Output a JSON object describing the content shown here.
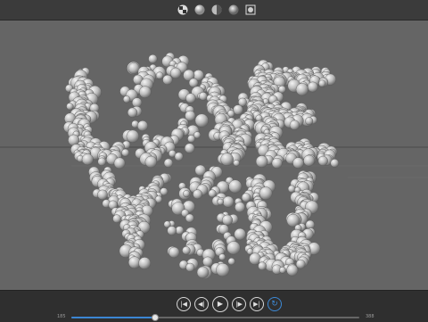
{
  "toolbar": {
    "icons": [
      {
        "name": "checker-render-icon"
      },
      {
        "name": "solid-sphere-icon"
      },
      {
        "name": "material-sphere-icon"
      },
      {
        "name": "shaded-sphere-icon"
      },
      {
        "name": "frame-select-icon"
      }
    ]
  },
  "viewport": {
    "background": "#656565",
    "text_line1": "LOVE",
    "text_line2": "YOU",
    "sphere_color": "#c9c9c9"
  },
  "playback": {
    "buttons": [
      "skip-to-start",
      "step-back",
      "play",
      "step-forward",
      "skip-to-end",
      "loop"
    ],
    "frame_start": "185",
    "frame_end": "388",
    "progress": 0.29,
    "accent": "#3b86d3"
  }
}
